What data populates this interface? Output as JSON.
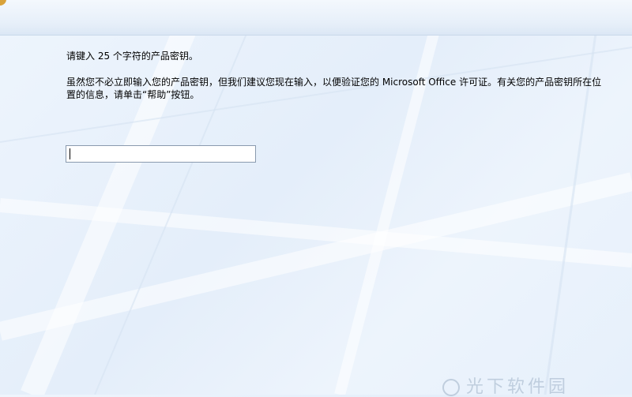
{
  "installer": {
    "prompt": "请键入 25 个字符的产品密钥。",
    "description": "虽然您不必立即输入您的产品密钥，但我们建议您现在输入，以便验证您的 Microsoft Office 许可证。有关您的产品密钥所在位置的信息，请单击“帮助”按钮。",
    "product_key_value": ""
  },
  "watermark": {
    "text": "光下软件园",
    "logo": "site-logo-icon"
  },
  "colors": {
    "background": "#e8f1fb",
    "input_border": "#8a9aae",
    "accent": "#d9a23a"
  }
}
